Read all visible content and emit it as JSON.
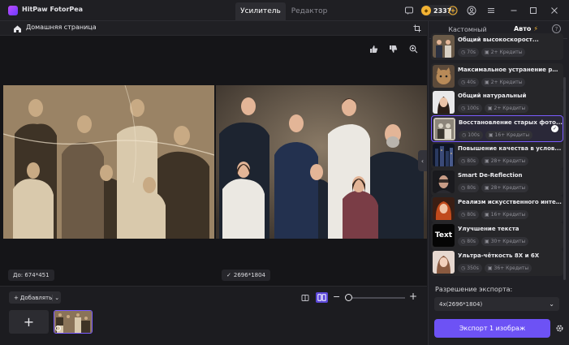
{
  "app": {
    "name": "HitPaw FotorPea"
  },
  "top_tabs": [
    {
      "label": "Усилитель",
      "active": true
    },
    {
      "label": "Редактор",
      "active": false
    }
  ],
  "credits": {
    "count": "2337"
  },
  "home": {
    "label": "Домашняя страница"
  },
  "canvas": {
    "before_label": "До: 674*451",
    "after_label": "2696*1804"
  },
  "bottom": {
    "add_label": "Добавлять"
  },
  "right_panel": {
    "tabs": [
      {
        "label": "Кастомный"
      },
      {
        "label": "Авто"
      }
    ],
    "models": [
      {
        "name": "Общий высокоскорост...",
        "time": "70s",
        "credits": "2+ Кредиты",
        "thumb": "family"
      },
      {
        "name": "Максимальное устранение ра...",
        "time": "40s",
        "credits": "2+ Кредиты",
        "thumb": "cat"
      },
      {
        "name": "Общий натуральный",
        "time": "100s",
        "credits": "2+ Кредиты",
        "thumb": "woman"
      },
      {
        "name": "Восстановление старых фото...",
        "time": "100s",
        "credits": "16+ Кредиты",
        "thumb": "oldphoto",
        "selected": true
      },
      {
        "name": "Повышение качества в услов...",
        "time": "80s",
        "credits": "28+ Кредиты",
        "thumb": "night"
      },
      {
        "name": "Smart De-Reflection",
        "time": "80s",
        "credits": "28+ Кредиты",
        "thumb": "reflection"
      },
      {
        "name": "Реализм искусственного инте...",
        "time": "80s",
        "credits": "16+ Кредиты",
        "thumb": "redhair"
      },
      {
        "name": "Улучшение текста",
        "time": "80s",
        "credits": "30+ Кредиты",
        "thumb": "text",
        "thumb_text": "Text"
      },
      {
        "name": "Ультра-чёткость 8X и 6X",
        "time": "350s",
        "credits": "36+ Кредиты",
        "thumb": "portrait"
      }
    ],
    "export_label": "Разрешение экспорта:",
    "export_value": "4x(2696*1804)",
    "export_button": "Экспорт 1 изображ"
  },
  "colors": {
    "accent": "#7a5cff",
    "export_button": "#6d52f5",
    "coin": "#f2b233"
  }
}
